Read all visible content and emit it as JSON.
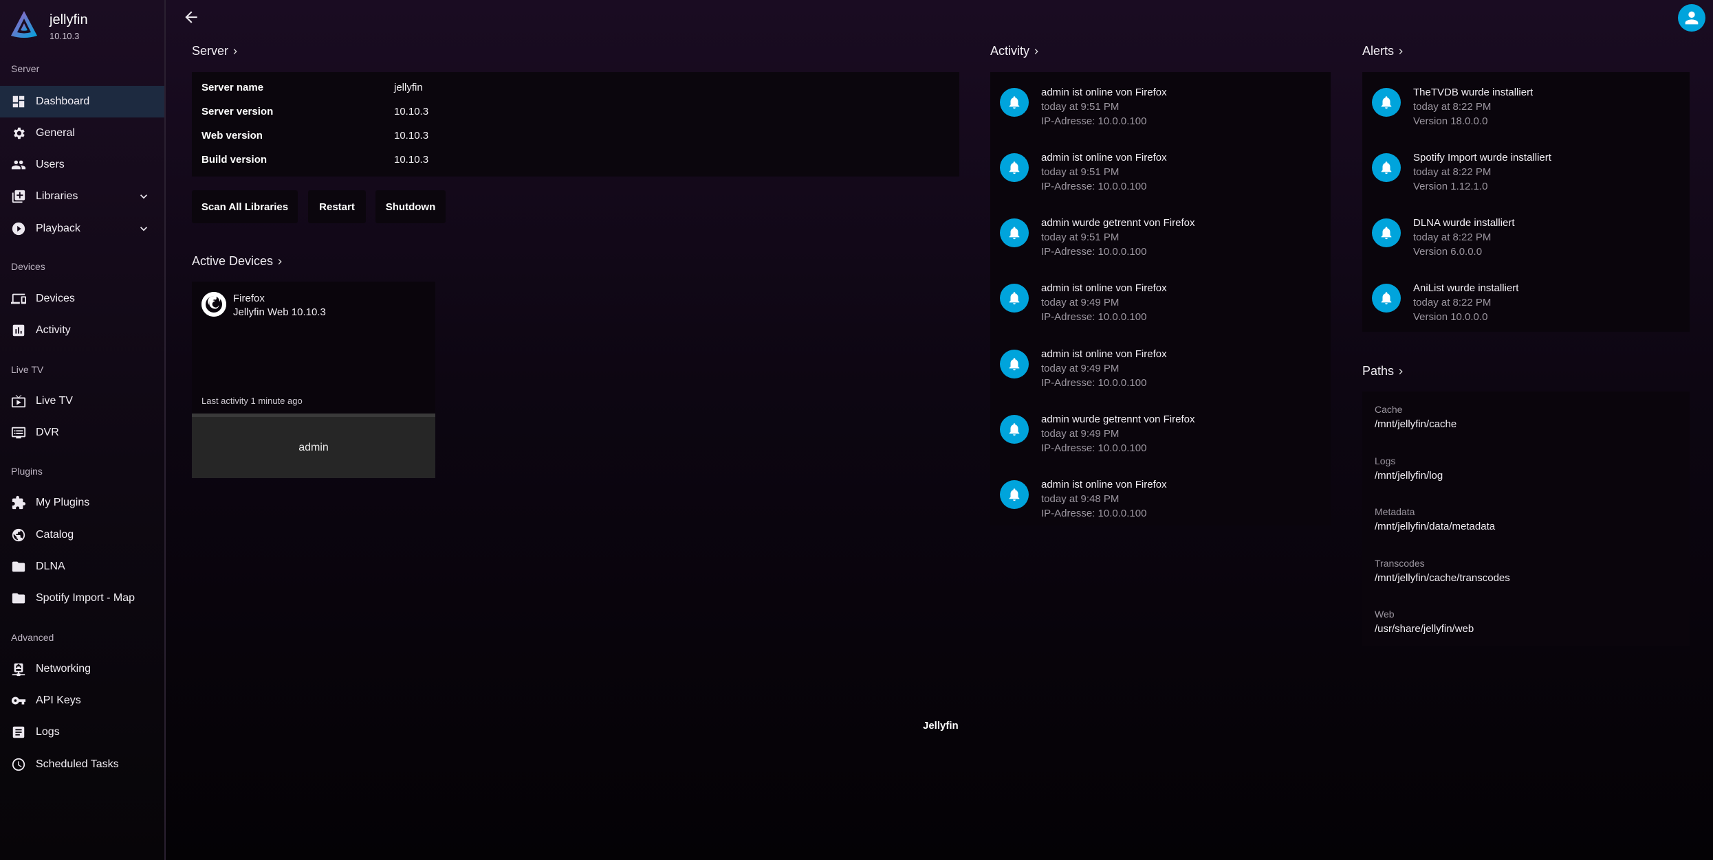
{
  "brand": {
    "name": "jellyfin",
    "version": "10.10.3"
  },
  "sidebar": {
    "sections": [
      "Server",
      "Devices",
      "Live TV",
      "Plugins",
      "Advanced"
    ],
    "items": [
      {
        "label": "Dashboard"
      },
      {
        "label": "General"
      },
      {
        "label": "Users"
      },
      {
        "label": "Libraries"
      },
      {
        "label": "Playback"
      },
      {
        "label": "Devices"
      },
      {
        "label": "Activity"
      },
      {
        "label": "Live TV"
      },
      {
        "label": "DVR"
      },
      {
        "label": "My Plugins"
      },
      {
        "label": "Catalog"
      },
      {
        "label": "DLNA"
      },
      {
        "label": "Spotify Import - Map"
      },
      {
        "label": "Networking"
      },
      {
        "label": "API Keys"
      },
      {
        "label": "Logs"
      },
      {
        "label": "Scheduled Tasks"
      }
    ]
  },
  "server": {
    "title": "Server",
    "rows": [
      {
        "key": "Server name",
        "value": "jellyfin"
      },
      {
        "key": "Server version",
        "value": "10.10.3"
      },
      {
        "key": "Web version",
        "value": "10.10.3"
      },
      {
        "key": "Build version",
        "value": "10.10.3"
      }
    ],
    "buttons": {
      "scan": "Scan All Libraries",
      "restart": "Restart",
      "shutdown": "Shutdown"
    }
  },
  "devices": {
    "title": "Active Devices",
    "card": {
      "name": "Firefox",
      "app": "Jellyfin Web 10.10.3",
      "last_activity": "Last activity 1 minute ago",
      "user": "admin"
    }
  },
  "activity": {
    "title": "Activity",
    "items": [
      {
        "title": "admin ist online von Firefox",
        "time": "today at 9:51 PM",
        "sub": "IP-Adresse: 10.0.0.100"
      },
      {
        "title": "admin ist online von Firefox",
        "time": "today at 9:51 PM",
        "sub": "IP-Adresse: 10.0.0.100"
      },
      {
        "title": "admin wurde getrennt von Firefox",
        "time": "today at 9:51 PM",
        "sub": "IP-Adresse: 10.0.0.100"
      },
      {
        "title": "admin ist online von Firefox",
        "time": "today at 9:49 PM",
        "sub": "IP-Adresse: 10.0.0.100"
      },
      {
        "title": "admin ist online von Firefox",
        "time": "today at 9:49 PM",
        "sub": "IP-Adresse: 10.0.0.100"
      },
      {
        "title": "admin wurde getrennt von Firefox",
        "time": "today at 9:49 PM",
        "sub": "IP-Adresse: 10.0.0.100"
      },
      {
        "title": "admin ist online von Firefox",
        "time": "today at 9:48 PM",
        "sub": "IP-Adresse: 10.0.0.100"
      }
    ]
  },
  "alerts": {
    "title": "Alerts",
    "items": [
      {
        "title": "TheTVDB wurde installiert",
        "time": "today at 8:22 PM",
        "sub": "Version 18.0.0.0"
      },
      {
        "title": "Spotify Import wurde installiert",
        "time": "today at 8:22 PM",
        "sub": "Version 1.12.1.0"
      },
      {
        "title": "DLNA wurde installiert",
        "time": "today at 8:22 PM",
        "sub": "Version 6.0.0.0"
      },
      {
        "title": "AniList wurde installiert",
        "time": "today at 8:22 PM",
        "sub": "Version 10.0.0.0"
      }
    ]
  },
  "paths": {
    "title": "Paths",
    "items": [
      {
        "label": "Cache",
        "value": "/mnt/jellyfin/cache"
      },
      {
        "label": "Logs",
        "value": "/mnt/jellyfin/log"
      },
      {
        "label": "Metadata",
        "value": "/mnt/jellyfin/data/metadata"
      },
      {
        "label": "Transcodes",
        "value": "/mnt/jellyfin/cache/transcodes"
      },
      {
        "label": "Web",
        "value": "/usr/share/jellyfin/web"
      }
    ]
  },
  "footer": {
    "text": "Jellyfin"
  },
  "colors": {
    "accent": "#00a4dc",
    "active_item": "#1d2a40"
  }
}
